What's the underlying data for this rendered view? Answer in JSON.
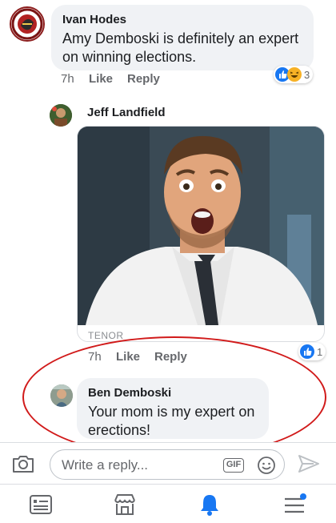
{
  "comments": [
    {
      "author": "Ivan Hodes",
      "text_line1": "Amy Demboski is definitely an expert",
      "text_line2": "on winning elections.",
      "time": "7h",
      "like_label": "Like",
      "reply_label": "Reply",
      "reactions": [
        "like",
        "haha"
      ],
      "reaction_count": "3"
    },
    {
      "author": "Jeff Landfield",
      "gif_provider": "TENOR",
      "time": "7h",
      "like_label": "Like",
      "reply_label": "Reply",
      "reactions": [
        "like"
      ],
      "reaction_count": "1"
    },
    {
      "author": "Ben Demboski",
      "text_line1": "Your mom is my expert on",
      "text_line2": "erections!"
    }
  ],
  "composer": {
    "placeholder": "Write a reply...",
    "gif_label": "GIF",
    "icons": [
      "camera-icon",
      "gif-icon",
      "emoji-icon",
      "send-icon"
    ]
  },
  "tabbar": {
    "items": [
      "news-feed-icon",
      "marketplace-icon",
      "notifications-icon",
      "menu-icon"
    ],
    "active": "notifications-icon",
    "active_color": "#1877f2"
  },
  "colors": {
    "annotation": "#d11a1a",
    "like_blue": "#1877f2",
    "haha_yellow": "#f7b125"
  }
}
